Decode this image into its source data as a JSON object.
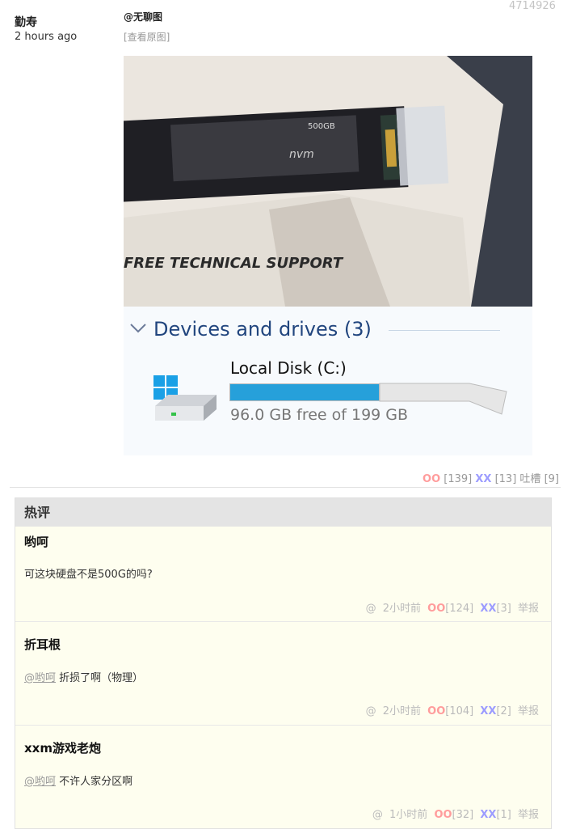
{
  "post": {
    "id": "4714926",
    "author": "勤寿",
    "time": "2 hours ago",
    "title": "@无聊图",
    "view_original": "[查看原图]"
  },
  "image": {
    "photo_texts": [
      "500GB",
      "nvm",
      "FREE TECHNICAL SUPPORT"
    ],
    "screenshot": {
      "section_title": "Devices and drives (3)",
      "disk_name": "Local Disk (C:)",
      "disk_free": "96.0 GB free of 199 GB",
      "used_fraction": 0.52
    }
  },
  "votes": {
    "oo_label": "OO",
    "oo_count": "[139]",
    "xx_label": "XX",
    "xx_count": "[13]",
    "tucao_label": "吐槽",
    "tucao_count": "[9]"
  },
  "hot_comments": {
    "header": "热评",
    "items": [
      {
        "author": "哟呵",
        "mention": "",
        "text": "可这块硬盘不是500G的吗?",
        "at": "@",
        "time": "2小时前",
        "oo_label": "OO",
        "oo_count": "[124]",
        "xx_label": "XX",
        "xx_count": "[3]",
        "report": "举报"
      },
      {
        "author": "折耳根",
        "mention": "@哟呵",
        "text": "折损了啊（物理）",
        "at": "@",
        "time": "2小时前",
        "oo_label": "OO",
        "oo_count": "[104]",
        "xx_label": "XX",
        "xx_count": "[2]",
        "report": "举报"
      },
      {
        "author": "xxm游戏老炮",
        "mention": "@哟呵",
        "text": "不许人家分区啊",
        "at": "@",
        "time": "1小时前",
        "oo_label": "OO",
        "oo_count": "[32]",
        "xx_label": "XX",
        "xx_count": "[1]",
        "report": "举报"
      }
    ]
  },
  "colors": {
    "oo": "#ff9c9c",
    "xx": "#9c9cff",
    "comment_bg": "#fefeef",
    "header_bg": "#e4e4e4",
    "disk_bar": "#26a0da"
  }
}
